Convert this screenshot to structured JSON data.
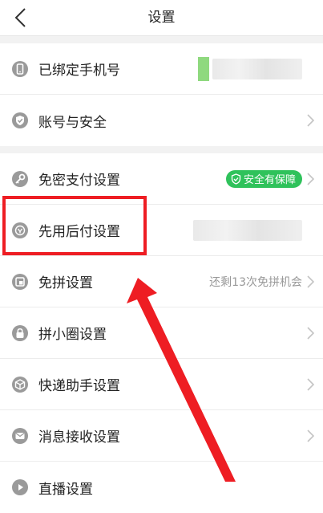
{
  "navbar": {
    "title": "设置"
  },
  "groups": [
    {
      "items": [
        {
          "id": "phone",
          "label": "已绑定手机号",
          "icon": "phone-icon"
        },
        {
          "id": "account",
          "label": "账号与安全",
          "icon": "shield-check-icon"
        }
      ]
    },
    {
      "items": [
        {
          "id": "nopwd",
          "label": "免密支付设置",
          "icon": "key-icon",
          "badge": "安全有保障"
        },
        {
          "id": "paylater",
          "label": "先用后付设置",
          "icon": "paylater-icon"
        },
        {
          "id": "freegroup",
          "label": "免拼设置",
          "icon": "freegroup-icon",
          "value": "还剩13次免拼机会"
        },
        {
          "id": "circle",
          "label": "拼小圈设置",
          "icon": "lock-icon"
        },
        {
          "id": "express",
          "label": "快递助手设置",
          "icon": "package-icon"
        },
        {
          "id": "message",
          "label": "消息接收设置",
          "icon": "message-icon"
        },
        {
          "id": "live",
          "label": "直播设置",
          "icon": "live-icon"
        }
      ]
    }
  ],
  "colors": {
    "accent_green": "#2fc25b",
    "highlight_red": "#ee1d23",
    "icon_gray": "#9a9a9a"
  }
}
